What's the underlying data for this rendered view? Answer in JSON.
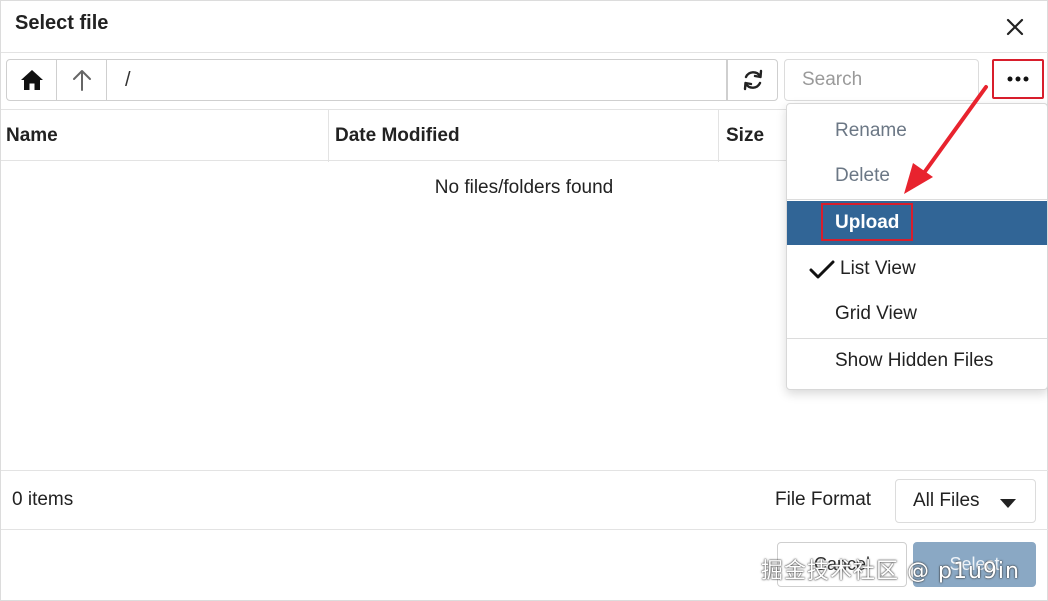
{
  "dialog": {
    "title": "Select file"
  },
  "toolbar": {
    "path": "/",
    "search_placeholder": "Search"
  },
  "table": {
    "columns": [
      "Name",
      "Date Modified",
      "Size"
    ],
    "empty_message": "No files/folders found"
  },
  "status": {
    "items_count": "0 items",
    "file_format_label": "File Format",
    "file_format_value": "All Files"
  },
  "footer": {
    "cancel_label": "Cancel",
    "select_label": "Select"
  },
  "menu": {
    "items": [
      {
        "label": "Rename",
        "state": "disabled"
      },
      {
        "label": "Delete",
        "state": "disabled"
      },
      {
        "label": "Upload",
        "state": "highlighted"
      },
      {
        "label": "List View",
        "state": "checked"
      },
      {
        "label": "Grid View",
        "state": "normal"
      },
      {
        "label": "Show Hidden Files",
        "state": "normal"
      }
    ]
  },
  "watermark": "掘金技术社区 @ p1u9in",
  "colors": {
    "highlight": "#316596",
    "annotation_red": "#d81e2c",
    "select_button": "#8aa8c4"
  }
}
